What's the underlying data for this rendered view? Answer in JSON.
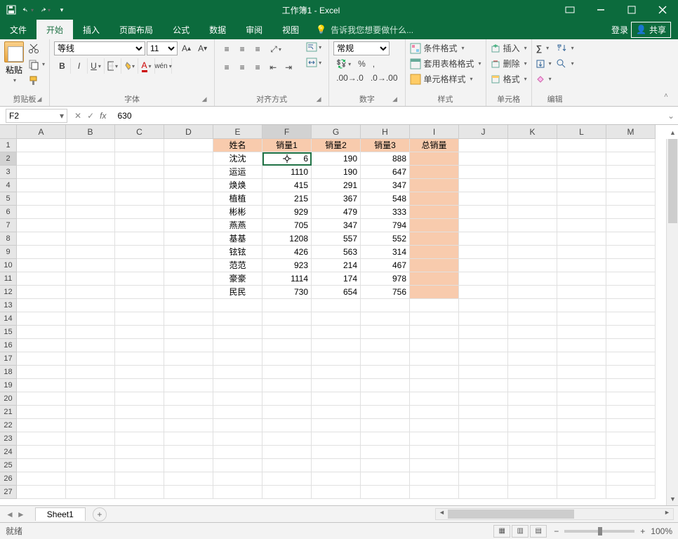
{
  "title": "工作簿1 - Excel",
  "tabs": {
    "file": "文件",
    "home": "开始",
    "insert": "插入",
    "layout": "页面布局",
    "formula": "公式",
    "data": "数据",
    "review": "审阅",
    "view": "视图"
  },
  "tell": "告诉我您想要做什么...",
  "login": "登录",
  "share": "共享",
  "ribbon": {
    "clip": {
      "paste": "粘贴",
      "label": "剪贴板"
    },
    "font": {
      "name": "等线",
      "size": "11",
      "label": "字体"
    },
    "align": {
      "wrap": "自动换行",
      "merge": "合并后居中",
      "label": "对齐方式"
    },
    "number": {
      "format": "常规",
      "label": "数字"
    },
    "styles": {
      "cond": "条件格式",
      "table": "套用表格格式",
      "cell": "单元格样式",
      "label": "样式"
    },
    "cells": {
      "insert": "插入",
      "delete": "删除",
      "format": "格式",
      "label": "单元格"
    },
    "edit": {
      "label": "编辑"
    }
  },
  "namebox": "F2",
  "formula": "630",
  "cols": [
    "A",
    "B",
    "C",
    "D",
    "E",
    "F",
    "G",
    "H",
    "I",
    "J",
    "K",
    "L",
    "M"
  ],
  "headers": {
    "E": "姓名",
    "F": "销量1",
    "G": "销量2",
    "H": "销量3",
    "I": "总销量"
  },
  "rows": [
    {
      "E": "沈沈",
      "F": "630",
      "G": "190",
      "H": "888"
    },
    {
      "E": "运运",
      "F": "1110",
      "G": "190",
      "H": "647"
    },
    {
      "E": "焕焕",
      "F": "415",
      "G": "291",
      "H": "347"
    },
    {
      "E": "植植",
      "F": "215",
      "G": "367",
      "H": "548"
    },
    {
      "E": "彬彬",
      "F": "929",
      "G": "479",
      "H": "333"
    },
    {
      "E": "燕燕",
      "F": "705",
      "G": "347",
      "H": "794"
    },
    {
      "E": "基基",
      "F": "1208",
      "G": "557",
      "H": "552"
    },
    {
      "E": "铉铉",
      "F": "426",
      "G": "563",
      "H": "314"
    },
    {
      "E": "范范",
      "F": "923",
      "G": "214",
      "H": "467"
    },
    {
      "E": "豪豪",
      "F": "1114",
      "G": "174",
      "H": "978"
    },
    {
      "E": "民民",
      "F": "730",
      "G": "654",
      "H": "756"
    }
  ],
  "active": {
    "col": "F",
    "row": 2,
    "display": "6"
  },
  "sheet_tab": "Sheet1",
  "status": {
    "ready": "就绪",
    "zoom": "100%"
  }
}
